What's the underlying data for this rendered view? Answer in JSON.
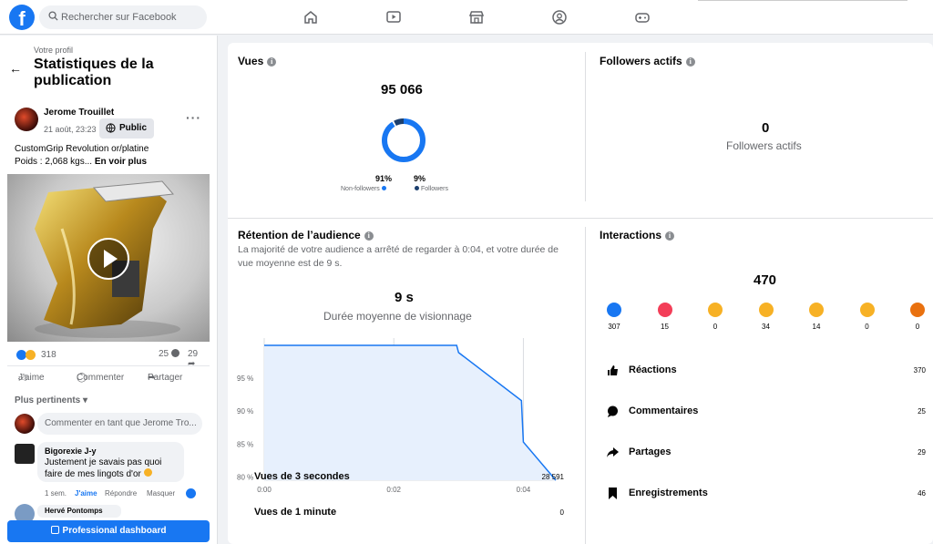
{
  "topbar": {
    "logo": "f",
    "search_placeholder": "Rechercher sur Facebook",
    "nav_icons": [
      "home-icon",
      "video-icon",
      "marketplace-icon",
      "groups-icon",
      "gaming-icon"
    ]
  },
  "left": {
    "profile_label": "Votre profil",
    "title": "Statistiques de la publication",
    "post": {
      "author": "Jerome Trouillet",
      "date": "21 août, 23:23 ·",
      "audience": "Public",
      "text_line1": "CustomGrip Revolution or/platine",
      "text_line2": "Poids : 2,068 kgs...",
      "see_more": "En voir plus",
      "reaction_count": "318",
      "comment_count": "25",
      "share_count": "29",
      "like_label": "J'aime",
      "comment_label": "Commenter",
      "share_label": "Partager"
    },
    "sort_label": "Plus pertinents",
    "comment_placeholder": "Commenter en tant que Jerome Tro...",
    "comment": {
      "author": "Bigorexie J-y",
      "text": "Justement je savais pas quoi faire de mes lingots d'or",
      "age": "1 sem.",
      "like": "J'aime",
      "reply": "Répondre",
      "hide": "Masquer"
    },
    "next_comment_author": "Hervé Pontomps",
    "pro_dashboard": "Professional dashboard"
  },
  "views": {
    "title": "Vues",
    "total": "95 066",
    "nonfollowers_pct": "91%",
    "followers_pct": "9%",
    "nonfollowers_fraction": 0.91,
    "nonfollowers_label": "Non-followers",
    "followers_label": "Followers",
    "nonfollowers_color": "#1877f2",
    "followers_color": "#1c3f6e"
  },
  "active_followers": {
    "title": "Followers actifs",
    "value": "0",
    "label": "Followers actifs"
  },
  "retention": {
    "title": "Rétention de l’audience",
    "description": "La majorité de votre audience a arrêté de regarder à 0:04, et votre durée de vue moyenne est de 9 s.",
    "avg_value": "9 s",
    "avg_label": "Durée moyenne de visionnage",
    "rows": [
      {
        "label": "Vues de 3 secondes",
        "value": "28 591"
      },
      {
        "label": "Vues de 1 minute",
        "value": "0"
      }
    ]
  },
  "interactions": {
    "title": "Interactions",
    "total": "470",
    "reactions": [
      {
        "name": "like-icon",
        "count": "307",
        "color": "#1877f2"
      },
      {
        "name": "love-icon",
        "count": "15",
        "color": "#f33e58"
      },
      {
        "name": "care-icon",
        "count": "0",
        "color": "#f7b125"
      },
      {
        "name": "haha-icon",
        "count": "34",
        "color": "#f7b125"
      },
      {
        "name": "wow-icon",
        "count": "14",
        "color": "#f7b125"
      },
      {
        "name": "sad-icon",
        "count": "0",
        "color": "#f7b125"
      },
      {
        "name": "angry-icon",
        "count": "0",
        "color": "#e9710f"
      }
    ],
    "rows": [
      {
        "label": "Réactions",
        "value": "370",
        "icon": "thumb-icon"
      },
      {
        "label": "Commentaires",
        "value": "25",
        "icon": "comment-icon"
      },
      {
        "label": "Partages",
        "value": "29",
        "icon": "share-icon"
      },
      {
        "label": "Enregistrements",
        "value": "46",
        "icon": "bookmark-icon"
      }
    ]
  },
  "chart_data": {
    "type": "area",
    "x": [
      "0:00",
      "0:01",
      "0:02",
      "0:03",
      "0:03",
      "0:04",
      "0:04",
      "0:05"
    ],
    "x_seconds": [
      0,
      1,
      2,
      2.97,
      3.0,
      3.97,
      4.0,
      4.5
    ],
    "values": [
      100,
      100,
      100,
      100,
      98.9,
      91.6,
      85.3,
      79.5
    ],
    "xticks": [
      "0:00",
      "0:02",
      "0:04"
    ],
    "yticks": [
      "95 %",
      "90 %",
      "85 %",
      "80 %"
    ],
    "ylim": [
      79.5,
      100
    ],
    "line_color": "#1877f2",
    "fill_color": "#e7f0fd"
  }
}
